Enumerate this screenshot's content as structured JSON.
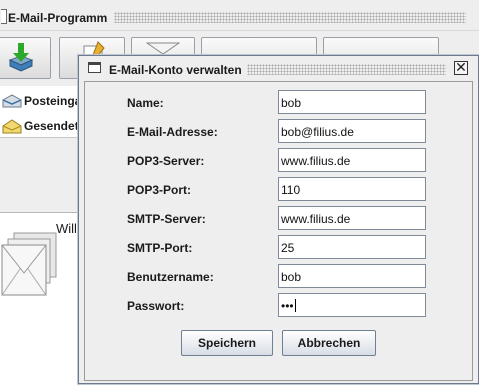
{
  "main_window": {
    "title": "E-Mail-Programm",
    "sidebar": {
      "items": [
        {
          "label": "Posteingang",
          "icon": "inbox-icon"
        },
        {
          "label": "Gesendet",
          "icon": "sent-icon"
        }
      ]
    },
    "preview_text": "Will"
  },
  "dialog": {
    "title": "E-Mail-Konto verwalten",
    "fields": [
      {
        "label": "Name:",
        "value": "bob"
      },
      {
        "label": "E-Mail-Adresse:",
        "value": "bob@filius.de"
      },
      {
        "label": "POP3-Server:",
        "value": "www.filius.de"
      },
      {
        "label": "POP3-Port:",
        "value": "110"
      },
      {
        "label": "SMTP-Server:",
        "value": "www.filius.de"
      },
      {
        "label": "SMTP-Port:",
        "value": "25"
      },
      {
        "label": "Benutzername:",
        "value": "bob"
      },
      {
        "label": "Passwort:",
        "value": "•••"
      }
    ],
    "save_label": "Speichern",
    "cancel_label": "Abbrechen"
  }
}
